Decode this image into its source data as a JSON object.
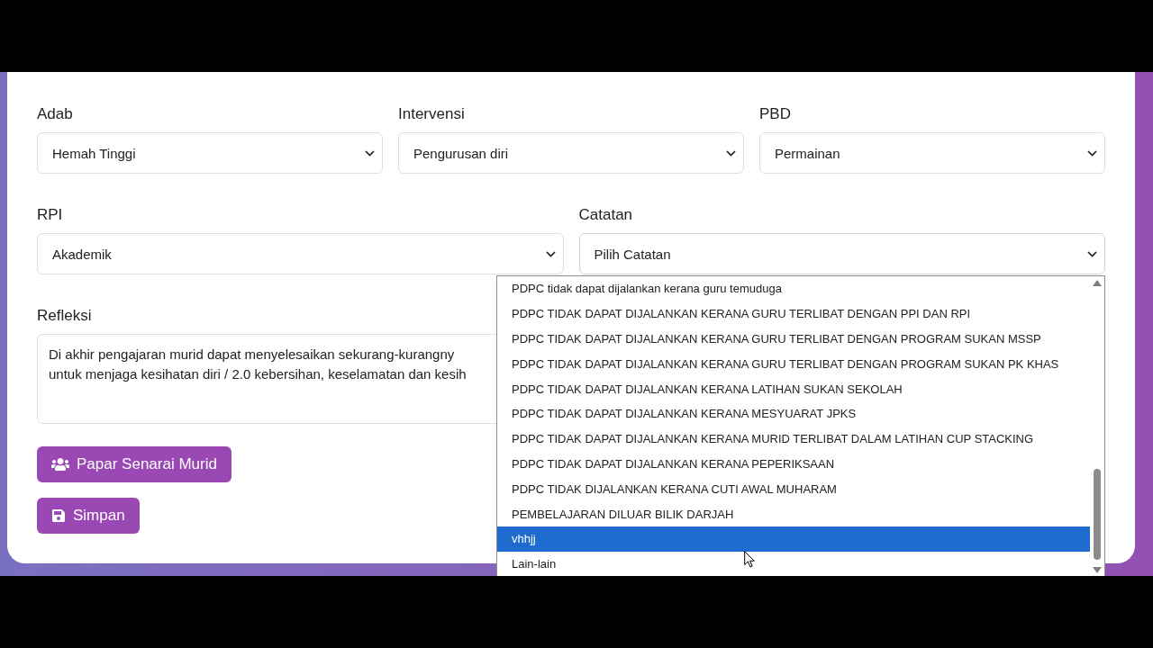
{
  "rows": [
    {
      "fields": [
        {
          "label": "Adab",
          "value": "Hemah Tinggi",
          "expanded": false
        },
        {
          "label": "Intervensi",
          "value": "Pengurusan diri",
          "expanded": false
        },
        {
          "label": "PBD",
          "value": "Permainan",
          "expanded": false
        }
      ]
    },
    {
      "fields": [
        {
          "label": "RPI",
          "value": "Akademik",
          "expanded": false
        },
        {
          "label": "Catatan",
          "value": "Pilih Catatan",
          "expanded": true,
          "options": [
            {
              "label": "PDPC tidak dapat dijalankan kerana guru temuduga",
              "selected": false
            },
            {
              "label": "PDPC TIDAK DAPAT DIJALANKAN KERANA GURU TERLIBAT DENGAN PPI DAN RPI",
              "selected": false
            },
            {
              "label": "PDPC TIDAK DAPAT DIJALANKAN KERANA GURU TERLIBAT DENGAN PROGRAM SUKAN MSSP",
              "selected": false
            },
            {
              "label": "PDPC TIDAK DAPAT DIJALANKAN KERANA GURU TERLIBAT DENGAN PROGRAM SUKAN PK KHAS",
              "selected": false
            },
            {
              "label": "PDPC TIDAK DAPAT DIJALANKAN KERANA LATIHAN SUKAN SEKOLAH",
              "selected": false
            },
            {
              "label": "PDPC TIDAK DAPAT DIJALANKAN KERANA MESYUARAT JPKS",
              "selected": false
            },
            {
              "label": "PDPC TIDAK DAPAT DIJALANKAN KERANA MURID TERLIBAT DALAM LATIHAN CUP STACKING",
              "selected": false
            },
            {
              "label": "PDPC TIDAK DAPAT DIJALANKAN KERANA PEPERIKSAAN",
              "selected": false
            },
            {
              "label": "PDPC TIDAK DIJALANKAN KERANA CUTI AWAL MUHARAM",
              "selected": false
            },
            {
              "label": "PEMBELAJARAN DILUAR BILIK DARJAH",
              "selected": false
            },
            {
              "label": "vhhjj",
              "selected": true
            },
            {
              "label": "Lain-lain",
              "selected": false
            }
          ]
        }
      ]
    }
  ],
  "refleksi": {
    "label": "Refleksi",
    "lines": [
      "Di akhir pengajaran murid dapat menyelesaikan sekurang-kurangny",
      "untuk menjaga kesihatan diri / 2.0 kebersihan, keselamatan dan kesih"
    ]
  },
  "buttons": [
    {
      "label": "Papar Senarai Murid",
      "kind": "users"
    },
    {
      "label": "Simpan",
      "kind": "save"
    }
  ]
}
